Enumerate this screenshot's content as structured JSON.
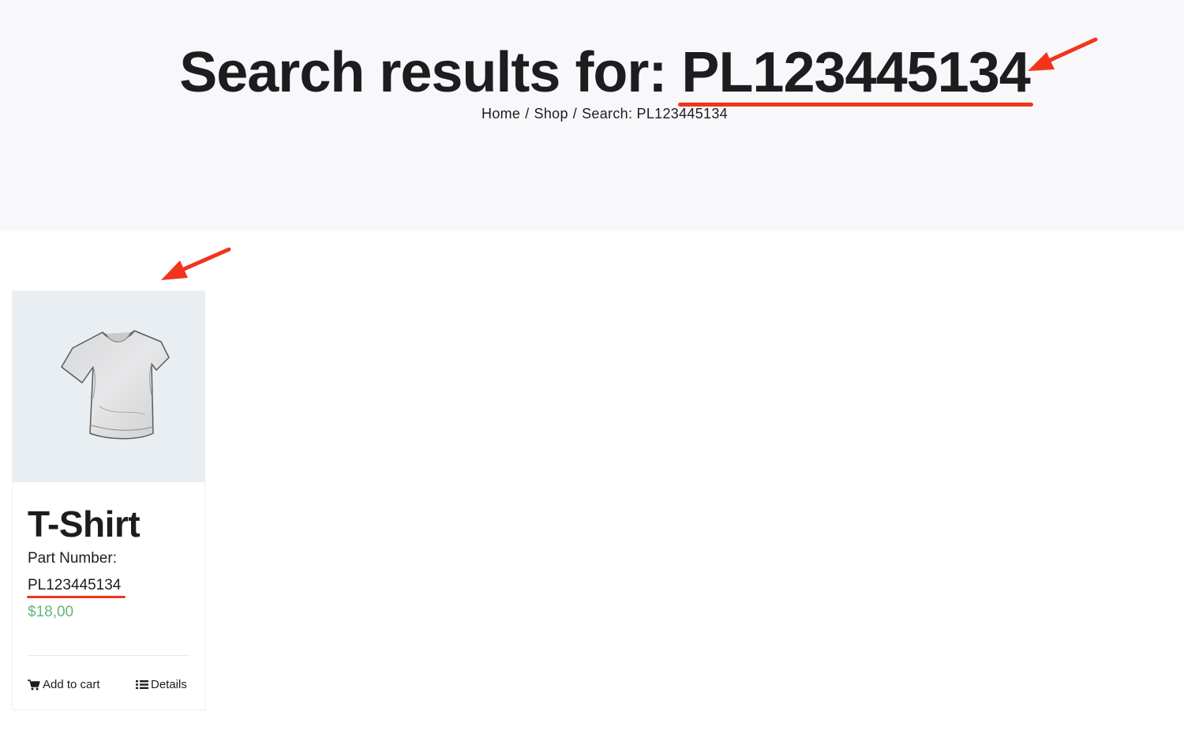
{
  "header": {
    "title_prefix": "Search results for: ",
    "query": "PL123445134",
    "breadcrumb": {
      "home": "Home",
      "shop": "Shop",
      "current": "Search: PL123445134",
      "separator": "/"
    }
  },
  "colors": {
    "annotation_red": "#f2341c",
    "price_green": "#5fb87a",
    "hero_background": "#f8f8fa",
    "image_background": "#e9eef2"
  },
  "product": {
    "image_icon": "t-shirt-image",
    "title": "T-Shirt",
    "part_label": "Part Number:",
    "part_number": "PL123445134",
    "price": "$18,00",
    "add_to_cart_label": "Add to cart",
    "add_to_cart_icon": "cart-icon",
    "details_label": "Details",
    "details_icon": "list-icon"
  }
}
